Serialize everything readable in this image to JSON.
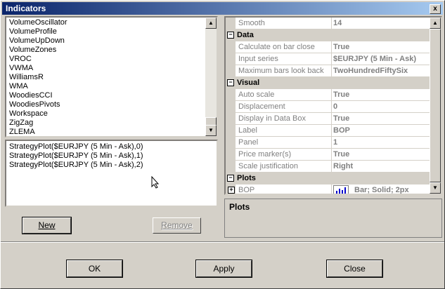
{
  "window": {
    "title": "Indicators",
    "close": "x"
  },
  "indicators": {
    "items": [
      "VolumeOscillator",
      "VolumeProfile",
      "VolumeUpDown",
      "VolumeZones",
      "VROC",
      "VWMA",
      "WilliamsR",
      "WMA",
      "WoodiesCCI",
      "WoodiesPivots",
      "Workspace",
      "ZigZag",
      "ZLEMA"
    ]
  },
  "plots_list": {
    "items": [
      "StrategyPlot($EURJPY (5 Min - Ask),0)",
      "StrategyPlot($EURJPY (5 Min - Ask),1)",
      "StrategyPlot($EURJPY (5 Min - Ask),2)"
    ]
  },
  "buttons": {
    "new": "New",
    "remove": "Remove",
    "ok": "OK",
    "apply": "Apply",
    "close": "Close"
  },
  "properties": {
    "smooth": {
      "name": "Smooth",
      "value": "14"
    },
    "data": {
      "category": "Data",
      "calc": {
        "name": "Calculate on bar close",
        "value": "True"
      },
      "input": {
        "name": "Input series",
        "value": "$EURJPY (5 Min - Ask)"
      },
      "maxbars": {
        "name": "Maximum bars look back",
        "value": "TwoHundredFiftySix"
      }
    },
    "visual": {
      "category": "Visual",
      "autoscale": {
        "name": "Auto scale",
        "value": "True"
      },
      "displacement": {
        "name": "Displacement",
        "value": "0"
      },
      "databox": {
        "name": "Display in Data Box",
        "value": "True"
      },
      "label": {
        "name": "Label",
        "value": "BOP"
      },
      "panel": {
        "name": "Panel",
        "value": "1"
      },
      "pricemarker": {
        "name": "Price marker(s)",
        "value": "True"
      },
      "scalejust": {
        "name": "Scale justification",
        "value": "Right"
      }
    },
    "plots": {
      "category": "Plots",
      "bop": {
        "name": "BOP",
        "value": "Bar; Solid; 2px"
      }
    }
  },
  "description": {
    "title": "Plots"
  },
  "icons": {
    "expanded": "minus-box-icon",
    "collapsed": "plus-box-icon"
  }
}
